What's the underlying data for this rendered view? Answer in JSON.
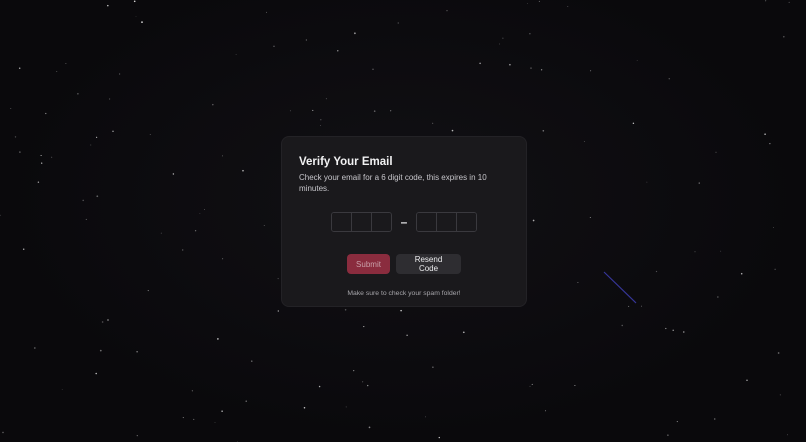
{
  "verify": {
    "title": "Verify Your Email",
    "description": "Check your email for a 6 digit code, this expires in 10 minutes.",
    "separator": "–",
    "code_group_1": [
      "",
      "",
      ""
    ],
    "code_group_2": [
      "",
      "",
      ""
    ],
    "submit_label": "Submit",
    "resend_label": "Resend Code",
    "note": "Make sure to check your spam folder!"
  },
  "colors": {
    "background": "#0b0a0d",
    "card": "#1a191c",
    "submit_button": "#8a2c3e",
    "resend_button": "#2e2d31",
    "shooting_star": "#3b3ba8"
  }
}
